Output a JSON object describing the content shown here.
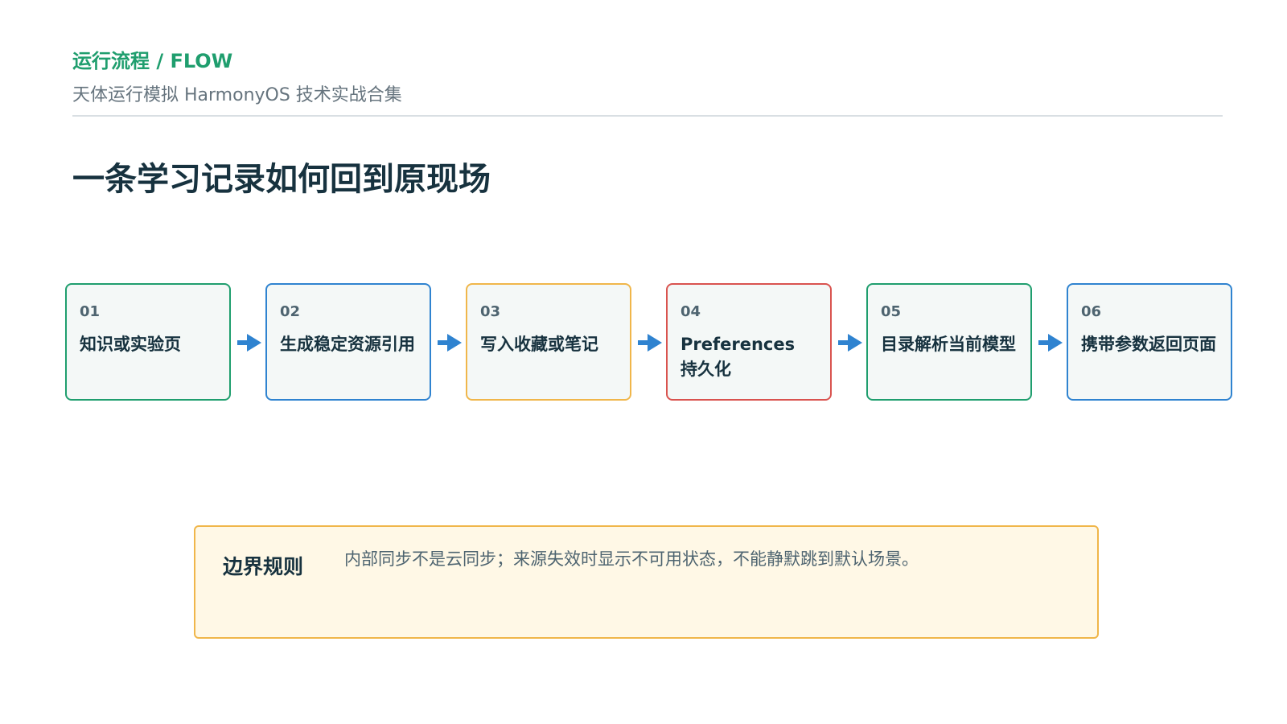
{
  "header": {
    "eyebrow": "运行流程 / FLOW",
    "subtitle": "天体运行模拟 HarmonyOS 技术实战合集"
  },
  "title": "一条学习记录如何回到原现场",
  "colors": {
    "green": "#1f9e6e",
    "blue": "#2f83d0",
    "amber": "#f0b64a",
    "red": "#d9534f",
    "arrow": "#2f83d0",
    "title": "#17323f",
    "muted": "#66747e"
  },
  "flow": {
    "steps": [
      {
        "num": "01",
        "label": "知识或实验页",
        "color": "#1f9e6e"
      },
      {
        "num": "02",
        "label": "生成稳定资源引用",
        "color": "#2f83d0"
      },
      {
        "num": "03",
        "label": "写入收藏或笔记",
        "color": "#f0b64a"
      },
      {
        "num": "04",
        "label": "Preferences 持久化",
        "color": "#d9534f"
      },
      {
        "num": "05",
        "label": "目录解析当前模型",
        "color": "#1f9e6e"
      },
      {
        "num": "06",
        "label": "携带参数返回页面",
        "color": "#2f83d0"
      }
    ],
    "arrow_icon": "arrow-right-icon"
  },
  "callout": {
    "title": "边界规则",
    "text": "内部同步不是云同步；来源失效时显示不可用状态，不能静默跳到默认场景。"
  }
}
